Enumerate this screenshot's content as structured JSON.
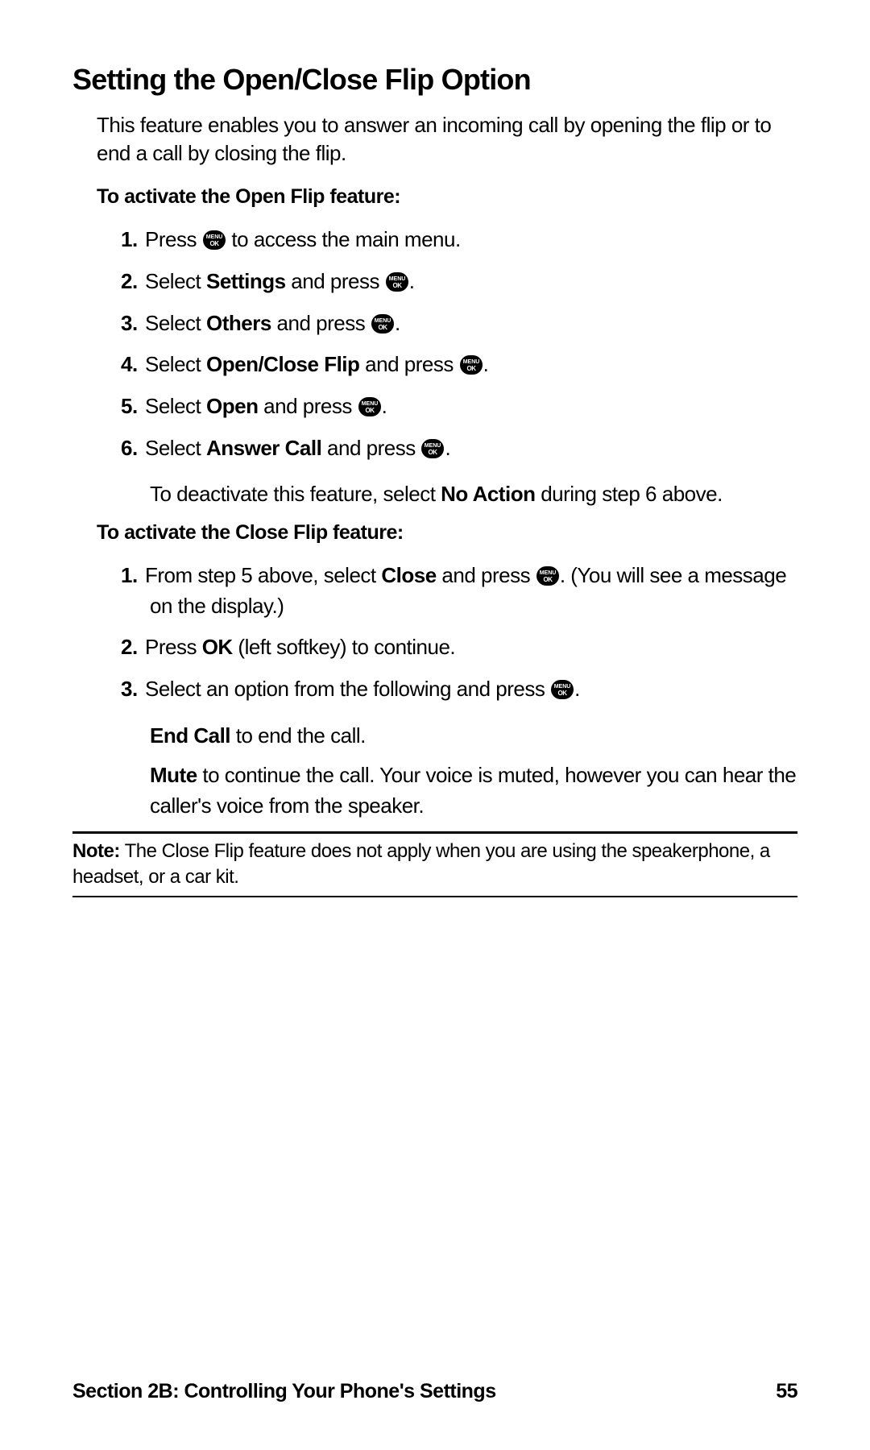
{
  "heading": "Setting the Open/Close Flip Option",
  "intro": "This feature enables you to answer an incoming call by opening the flip or to end a call by closing the flip.",
  "sub1": "To activate the Open Flip feature:",
  "open": {
    "s1a": "Press ",
    "s1b": " to access the main menu.",
    "s2a": "Select ",
    "s2b": "Settings",
    "s2c": " and press ",
    "s3a": "Select ",
    "s3b": "Others",
    "s3c": " and press ",
    "s4a": "Select ",
    "s4b": "Open/Close Flip",
    "s4c": " and press ",
    "s5a": "Select ",
    "s5b": "Open",
    "s5c": " and press ",
    "s6a": "Select ",
    "s6b": "Answer Call",
    "s6c": " and press ",
    "period": ".",
    "deact_a": "To deactivate this feature, select ",
    "deact_b": "No Action",
    "deact_c": " during step 6 above."
  },
  "sub2": "To activate the Close Flip feature:",
  "close": {
    "s1a": "From step 5 above, select ",
    "s1b": "Close",
    "s1c": " and press ",
    "s1d": ". (You will see a message on the display.)",
    "s2a": "Press ",
    "s2b": "OK",
    "s2c": " (left softkey) to continue.",
    "s3a": "Select an option from the following and press ",
    "s3b": ".",
    "opt1a": "End Call",
    "opt1b": " to end the call.",
    "opt2a": "Mute",
    "opt2b": " to continue the call. Your voice is muted, however you can hear the caller's voice from the speaker."
  },
  "note_label": "Note:",
  "note_body": " The Close Flip feature does not apply when you are using the speakerphone, a headset, or a car kit.",
  "footer_left": "Section 2B: Controlling Your Phone's Settings",
  "footer_right": "55",
  "nums": {
    "n1": "1.",
    "n2": "2.",
    "n3": "3.",
    "n4": "4.",
    "n5": "5.",
    "n6": "6."
  }
}
